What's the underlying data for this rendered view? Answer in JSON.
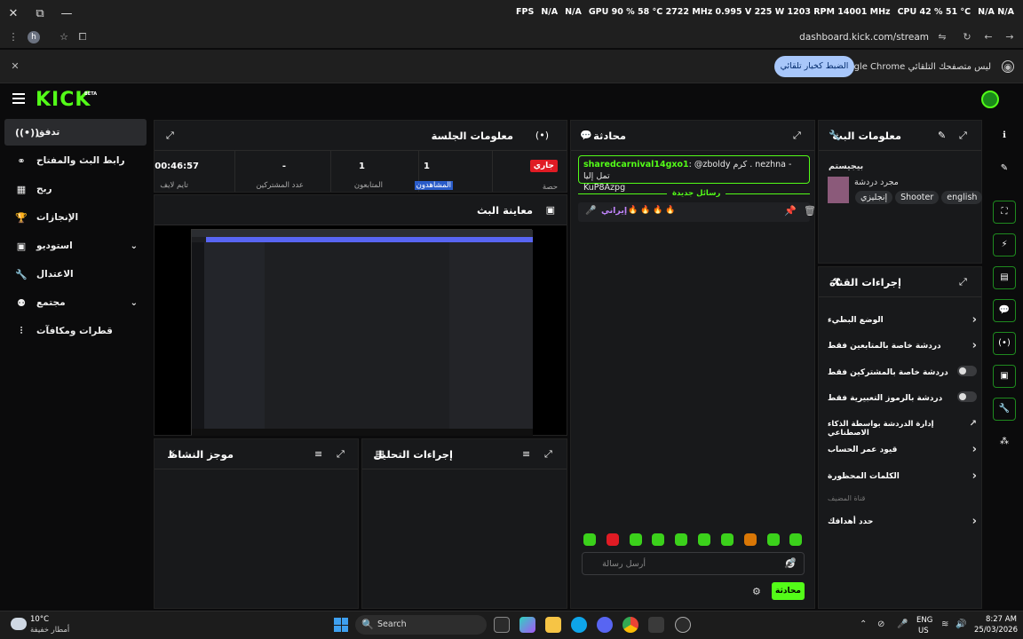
{
  "os_bar": {
    "fps_label": "FPS",
    "fps_a": "N/A",
    "fps_b": "N/A",
    "gpu": "GPU 90 % 58 °C 2722 MHz 0.995 V 225 W 1203 RPM 14001 MHz",
    "cpu": "CPU 42 % 51 °C",
    "tail": "N/A N/A"
  },
  "browser": {
    "url": "dashboard.kick.com/stream",
    "profile_initial": "h",
    "info_text": "Google Chrome ليس متصفحك التلقائي",
    "info_button": "الضبط كخيار تلقائي"
  },
  "kick": {
    "logo": "KICK",
    "beta": "BETA"
  },
  "sidebar": {
    "items": [
      {
        "label": "تدفق",
        "icon": "broadcast-icon"
      },
      {
        "label": "رابط البث والمفتاح",
        "icon": "link-icon"
      },
      {
        "label": "ربح",
        "icon": "dollar-icon"
      },
      {
        "label": "الإنجازات",
        "icon": "trophy-icon"
      },
      {
        "label": "استوديو",
        "icon": "studio-icon"
      },
      {
        "label": "الاعتدال",
        "icon": "wrench-icon"
      },
      {
        "label": "مجتمع",
        "icon": "community-icon"
      },
      {
        "label": "قطرات ومكافآت",
        "icon": "drops-icon"
      }
    ]
  },
  "session": {
    "title": "معلومات الجلسة",
    "live_badge": "جاري",
    "share_label": "حصة",
    "stats": [
      {
        "value": "1",
        "label": "المشاهدون"
      },
      {
        "value": "1",
        "label": "المتابعون"
      },
      {
        "value": "-",
        "label": "عدد المشتركين"
      },
      {
        "value": "00:46:57",
        "label": "تايم لايف"
      }
    ]
  },
  "preview": {
    "title": "معاينة البث"
  },
  "activity": {
    "title": "موجز النشاط"
  },
  "mod_actions": {
    "title": "إجراءات التحليل"
  },
  "chat": {
    "title": "محادثة",
    "pinned_user": "sharedcarnival14gxo1",
    "pinned_text": ": @zboldy كرم . nezhna - تمل إليا",
    "pinned_code": "KuP8Azpg",
    "new_messages": "رسائل جديدة",
    "msg_user": "إيراني",
    "input_placeholder": "أرسل رسالة",
    "send_button": "محادثة"
  },
  "stream_info": {
    "title": "معلومات البث",
    "stream_title": "بيجيستم",
    "category": "مجرد دردشة",
    "tags": [
      "english",
      "Shooter",
      "إنجليزي"
    ]
  },
  "channel_actions": {
    "title": "إجراءات القناة",
    "items": [
      {
        "label": "الوضع البطيء",
        "control": "arrow"
      },
      {
        "label": "دردشة خاصة بالمتابعين فقط",
        "control": "arrow"
      },
      {
        "label": "دردشة خاصة بالمشتركين فقط",
        "control": "toggle"
      },
      {
        "label": "دردشة بالرموز التعبيرية فقط",
        "control": "toggle"
      },
      {
        "label": "إدارة الدردشة بواسطة الذكاء الاصطناعي",
        "control": "external"
      },
      {
        "label": "قيود عمر الحساب",
        "control": "arrow"
      },
      {
        "label": "الكلمات المحظورة",
        "control": "arrow"
      },
      {
        "label": "قناة المضيف",
        "control": "none"
      },
      {
        "label": "حدد أهدافك",
        "control": "arrow"
      }
    ]
  },
  "taskbar": {
    "weather_temp": "10°C",
    "weather_desc": "أمطار خفيفة",
    "search": "Search",
    "lang": "ENG",
    "region": "US",
    "time": "8:27 AM",
    "date": "25/03/2026"
  },
  "colors": {
    "accent": "#53fc18",
    "panel": "#18191b",
    "bg": "#0b0b0c"
  }
}
